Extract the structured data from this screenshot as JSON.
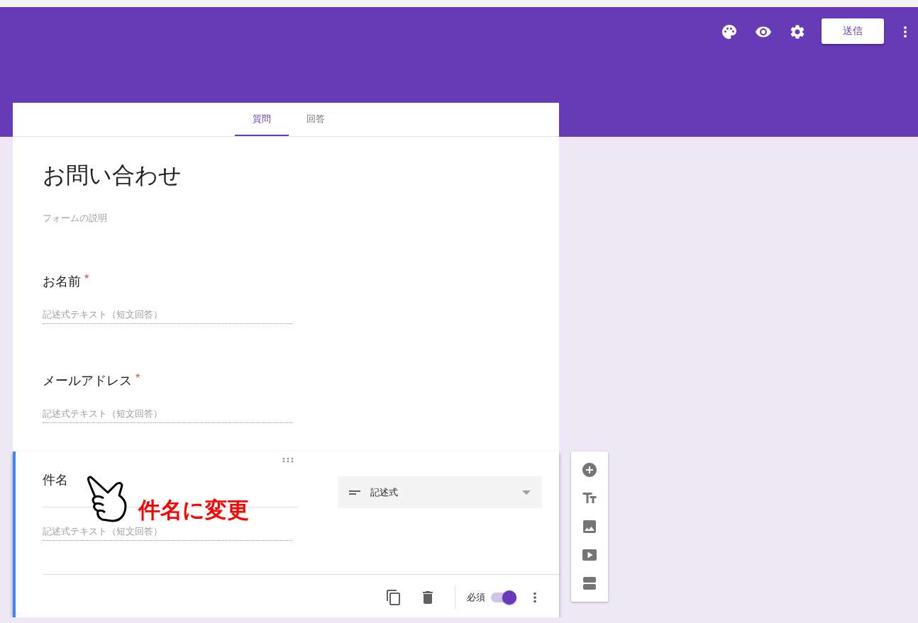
{
  "header": {
    "send_button": "送信"
  },
  "tabs": [
    {
      "label": "質問",
      "selected": true
    },
    {
      "label": "回答",
      "selected": false
    }
  ],
  "form": {
    "title": "お問い合わせ",
    "description_placeholder": "フォームの説明"
  },
  "questions": [
    {
      "title": "お名前",
      "required_mark": "*",
      "answer_placeholder": "記述式テキスト（短文回答）"
    },
    {
      "title": "メールアドレス",
      "required_mark": "*",
      "answer_placeholder": "記述式テキスト（短文回答）"
    }
  ],
  "active_question": {
    "title": "件名",
    "answer_placeholder": "記述式テキスト（短文回答）",
    "type_dropdown": "記述式",
    "required_label": "必須",
    "required": true
  },
  "annotation": {
    "text": "件名に変更"
  }
}
